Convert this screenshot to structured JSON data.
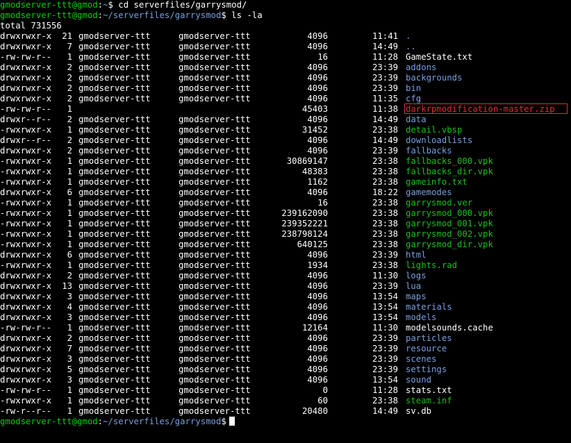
{
  "prompt": {
    "user_host": "gmodserver-ttt@gmod",
    "sep": ":",
    "home_path": "~",
    "dir_path": "~/serverfiles/garrysmod",
    "symbol": "$"
  },
  "commands": {
    "cd": "cd serverfiles/garrysmod/",
    "ls": "ls -la"
  },
  "total_line": "total 731556",
  "colors": {
    "background": "#000000",
    "prompt_user": "#00d000",
    "prompt_path": "#7a9fdf",
    "directory": "#7a9fdf",
    "executable": "#18c018",
    "regular_file": "#ffffff",
    "highlight_red": "#e03030"
  },
  "listing": [
    {
      "perms": "drwxrwxr-x",
      "links": "21",
      "owner": "gmodserver-ttt",
      "group": "gmodserver-ttt",
      "size": "4096",
      "time": "11:41",
      "name": ".",
      "kind": "dir"
    },
    {
      "perms": "drwxrwxr-x",
      "links": "7",
      "owner": "gmodserver-ttt",
      "group": "gmodserver-ttt",
      "size": "4096",
      "time": "14:49",
      "name": "..",
      "kind": "dir"
    },
    {
      "perms": "-rw-rw-r--",
      "links": "1",
      "owner": "gmodserver-ttt",
      "group": "gmodserver-ttt",
      "size": "16",
      "time": "11:28",
      "name": "GameState.txt",
      "kind": "file"
    },
    {
      "perms": "drwxrwxr-x",
      "links": "2",
      "owner": "gmodserver-ttt",
      "group": "gmodserver-ttt",
      "size": "4096",
      "time": "23:39",
      "name": "addons",
      "kind": "dir"
    },
    {
      "perms": "drwxrwxr-x",
      "links": "2",
      "owner": "gmodserver-ttt",
      "group": "gmodserver-ttt",
      "size": "4096",
      "time": "23:39",
      "name": "backgrounds",
      "kind": "dir"
    },
    {
      "perms": "drwxrwxr-x",
      "links": "2",
      "owner": "gmodserver-ttt",
      "group": "gmodserver-ttt",
      "size": "4096",
      "time": "23:39",
      "name": "bin",
      "kind": "dir"
    },
    {
      "perms": "drwxrwxr-x",
      "links": "2",
      "owner": "gmodserver-ttt",
      "group": "gmodserver-ttt",
      "size": "4096",
      "time": "11:35",
      "name": "cfg",
      "kind": "dir"
    },
    {
      "perms": "-rw-rw-r--",
      "links": "1",
      "owner": "",
      "group": "",
      "size": "45403",
      "time": "11:38",
      "name": "darkrpmodification-master.zip",
      "kind": "red",
      "redacted": true,
      "highlighted": true
    },
    {
      "perms": "drwxr--r--",
      "links": "2",
      "owner": "gmodserver-ttt",
      "group": "gmodserver-ttt",
      "size": "4096",
      "time": "14:49",
      "name": "data",
      "kind": "dir"
    },
    {
      "perms": "-rwxrwxr-x",
      "links": "1",
      "owner": "gmodserver-ttt",
      "group": "gmodserver-ttt",
      "size": "31452",
      "time": "23:38",
      "name": "detail.vbsp",
      "kind": "exec"
    },
    {
      "perms": "drwxr--r--",
      "links": "2",
      "owner": "gmodserver-ttt",
      "group": "gmodserver-ttt",
      "size": "4096",
      "time": "14:49",
      "name": "downloadlists",
      "kind": "dir"
    },
    {
      "perms": "drwxrwxr-x",
      "links": "2",
      "owner": "gmodserver-ttt",
      "group": "gmodserver-ttt",
      "size": "4096",
      "time": "23:39",
      "name": "fallbacks",
      "kind": "dir"
    },
    {
      "perms": "-rwxrwxr-x",
      "links": "1",
      "owner": "gmodserver-ttt",
      "group": "gmodserver-ttt",
      "size": "30869147",
      "time": "23:38",
      "name": "fallbacks_000.vpk",
      "kind": "exec"
    },
    {
      "perms": "-rwxrwxr-x",
      "links": "1",
      "owner": "gmodserver-ttt",
      "group": "gmodserver-ttt",
      "size": "48383",
      "time": "23:38",
      "name": "fallbacks_dir.vpk",
      "kind": "exec"
    },
    {
      "perms": "-rwxrwxr-x",
      "links": "1",
      "owner": "gmodserver-ttt",
      "group": "gmodserver-ttt",
      "size": "1162",
      "time": "23:38",
      "name": "gameinfo.txt",
      "kind": "exec"
    },
    {
      "perms": "drwxrwxr-x",
      "links": "6",
      "owner": "gmodserver-ttt",
      "group": "gmodserver-ttt",
      "size": "4096",
      "time": "18:22",
      "name": "gamemodes",
      "kind": "dir"
    },
    {
      "perms": "-rwxrwxr-x",
      "links": "1",
      "owner": "gmodserver-ttt",
      "group": "gmodserver-ttt",
      "size": "16",
      "time": "23:38",
      "name": "garrysmod.ver",
      "kind": "exec"
    },
    {
      "perms": "-rwxrwxr-x",
      "links": "1",
      "owner": "gmodserver-ttt",
      "group": "gmodserver-ttt",
      "size": "239162090",
      "time": "23:38",
      "name": "garrysmod_000.vpk",
      "kind": "exec"
    },
    {
      "perms": "-rwxrwxr-x",
      "links": "1",
      "owner": "gmodserver-ttt",
      "group": "gmodserver-ttt",
      "size": "239352221",
      "time": "23:38",
      "name": "garrysmod_001.vpk",
      "kind": "exec"
    },
    {
      "perms": "-rwxrwxr-x",
      "links": "1",
      "owner": "gmodserver-ttt",
      "group": "gmodserver-ttt",
      "size": "238798124",
      "time": "23:38",
      "name": "garrysmod_002.vpk",
      "kind": "exec"
    },
    {
      "perms": "-rwxrwxr-x",
      "links": "1",
      "owner": "gmodserver-ttt",
      "group": "gmodserver-ttt",
      "size": "640125",
      "time": "23:38",
      "name": "garrysmod_dir.vpk",
      "kind": "exec"
    },
    {
      "perms": "drwxrwxr-x",
      "links": "6",
      "owner": "gmodserver-ttt",
      "group": "gmodserver-ttt",
      "size": "4096",
      "time": "23:39",
      "name": "html",
      "kind": "dir"
    },
    {
      "perms": "-rwxrwxr-x",
      "links": "1",
      "owner": "gmodserver-ttt",
      "group": "gmodserver-ttt",
      "size": "1934",
      "time": "23:38",
      "name": "lights.rad",
      "kind": "exec"
    },
    {
      "perms": "drwxrwxr-x",
      "links": "2",
      "owner": "gmodserver-ttt",
      "group": "gmodserver-ttt",
      "size": "4096",
      "time": "11:30",
      "name": "logs",
      "kind": "dir"
    },
    {
      "perms": "drwxrwxr-x",
      "links": "13",
      "owner": "gmodserver-ttt",
      "group": "gmodserver-ttt",
      "size": "4096",
      "time": "23:39",
      "name": "lua",
      "kind": "dir"
    },
    {
      "perms": "drwxrwxr-x",
      "links": "3",
      "owner": "gmodserver-ttt",
      "group": "gmodserver-ttt",
      "size": "4096",
      "time": "13:54",
      "name": "maps",
      "kind": "dir"
    },
    {
      "perms": "drwxrwxr-x",
      "links": "4",
      "owner": "gmodserver-ttt",
      "group": "gmodserver-ttt",
      "size": "4096",
      "time": "13:54",
      "name": "materials",
      "kind": "dir"
    },
    {
      "perms": "drwxrwxr-x",
      "links": "3",
      "owner": "gmodserver-ttt",
      "group": "gmodserver-ttt",
      "size": "4096",
      "time": "13:54",
      "name": "models",
      "kind": "dir"
    },
    {
      "perms": "-rw-rw-r--",
      "links": "1",
      "owner": "gmodserver-ttt",
      "group": "gmodserver-ttt",
      "size": "12164",
      "time": "11:30",
      "name": "modelsounds.cache",
      "kind": "file"
    },
    {
      "perms": "drwxrwxr-x",
      "links": "2",
      "owner": "gmodserver-ttt",
      "group": "gmodserver-ttt",
      "size": "4096",
      "time": "23:39",
      "name": "particles",
      "kind": "dir"
    },
    {
      "perms": "drwxrwxr-x",
      "links": "7",
      "owner": "gmodserver-ttt",
      "group": "gmodserver-ttt",
      "size": "4096",
      "time": "23:39",
      "name": "resource",
      "kind": "dir"
    },
    {
      "perms": "drwxrwxr-x",
      "links": "3",
      "owner": "gmodserver-ttt",
      "group": "gmodserver-ttt",
      "size": "4096",
      "time": "23:39",
      "name": "scenes",
      "kind": "dir"
    },
    {
      "perms": "drwxrwxr-x",
      "links": "5",
      "owner": "gmodserver-ttt",
      "group": "gmodserver-ttt",
      "size": "4096",
      "time": "23:39",
      "name": "settings",
      "kind": "dir"
    },
    {
      "perms": "drwxrwxr-x",
      "links": "3",
      "owner": "gmodserver-ttt",
      "group": "gmodserver-ttt",
      "size": "4096",
      "time": "13:54",
      "name": "sound",
      "kind": "dir"
    },
    {
      "perms": "-rw-rw-r--",
      "links": "1",
      "owner": "gmodserver-ttt",
      "group": "gmodserver-ttt",
      "size": "0",
      "time": "11:28",
      "name": "stats.txt",
      "kind": "file"
    },
    {
      "perms": "-rwxrwxr-x",
      "links": "1",
      "owner": "gmodserver-ttt",
      "group": "gmodserver-ttt",
      "size": "60",
      "time": "23:38",
      "name": "steam.inf",
      "kind": "exec"
    },
    {
      "perms": "-rw-r--r--",
      "links": "1",
      "owner": "gmodserver-ttt",
      "group": "gmodserver-ttt",
      "size": "20480",
      "time": "14:49",
      "name": "sv.db",
      "kind": "file"
    }
  ]
}
